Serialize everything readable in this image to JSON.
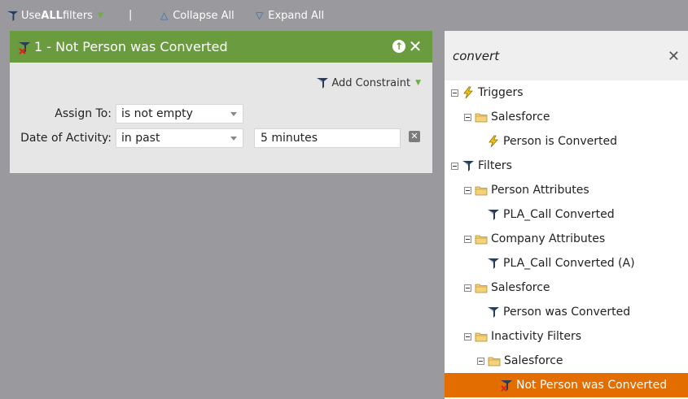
{
  "toolbar": {
    "use_prefix": "Use ",
    "use_bold": "ALL",
    "use_suffix": " filters",
    "separator": "|",
    "collapse_all": "Collapse All",
    "expand_all": "Expand All"
  },
  "filter_card": {
    "title": "1 - Not Person was Converted",
    "add_constraint": "Add Constraint",
    "rows": [
      {
        "label": "Assign To:",
        "value": "is not empty"
      },
      {
        "label": "Date of Activity:",
        "value": "in past",
        "extra_value": "5 minutes"
      }
    ]
  },
  "panel": {
    "search_query": "convert",
    "clear_icon": "close-icon",
    "tree": [
      {
        "label": "Triggers",
        "icon": "trigger-icon"
      },
      {
        "label": "Salesforce",
        "icon": "folder-icon"
      },
      {
        "label": "Person is Converted",
        "icon": "trigger-icon"
      },
      {
        "label": "Filters",
        "icon": "filter-icon"
      },
      {
        "label": "Person Attributes",
        "icon": "folder-icon"
      },
      {
        "label": "PLA_Call Converted",
        "icon": "filter-icon"
      },
      {
        "label": "Company Attributes",
        "icon": "folder-icon"
      },
      {
        "label": "PLA_Call Converted (A)",
        "icon": "filter-icon"
      },
      {
        "label": "Salesforce",
        "icon": "folder-icon"
      },
      {
        "label": "Person was Converted",
        "icon": "filter-icon"
      },
      {
        "label": "Inactivity Filters",
        "icon": "folder-icon"
      },
      {
        "label": "Salesforce",
        "icon": "folder-icon"
      },
      {
        "label": "Not Person was Converted",
        "icon": "not-filter-icon",
        "selected": true
      }
    ]
  },
  "colors": {
    "background": "#9a999d",
    "card_header": "#6b9b3f",
    "selected_row": "#e46d00",
    "accent_blue": "#2f6fb0"
  }
}
